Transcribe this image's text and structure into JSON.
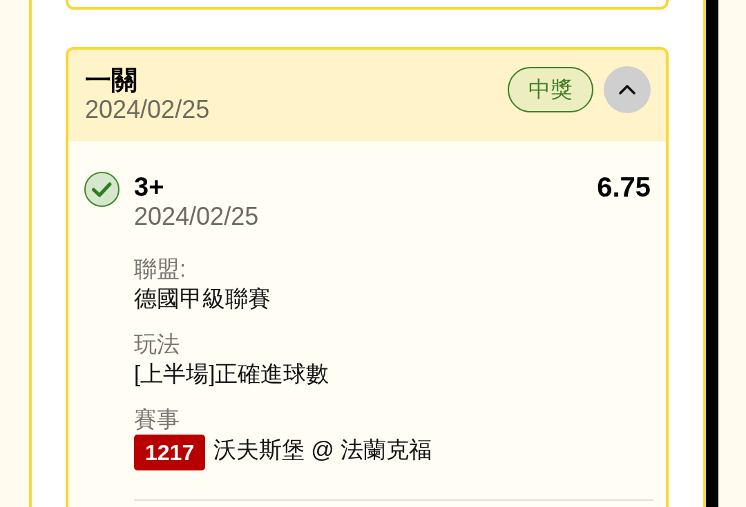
{
  "bet_card": {
    "title": "一關",
    "date": "2024/02/25",
    "status_badge": "中獎",
    "expanded": true,
    "selections": [
      {
        "won": true,
        "pick": "3+",
        "date": "2024/02/25",
        "odds": "6.75",
        "details": [
          {
            "kind": "text",
            "label": "聯盟:",
            "value": "德國甲級聯賽"
          },
          {
            "kind": "text",
            "label": "玩法",
            "value": "[上半場]正確進球數"
          },
          {
            "kind": "match",
            "label": "賽事",
            "match_number": "1217",
            "value": "沃夫斯堡 @ 法蘭克福"
          }
        ]
      }
    ]
  }
}
